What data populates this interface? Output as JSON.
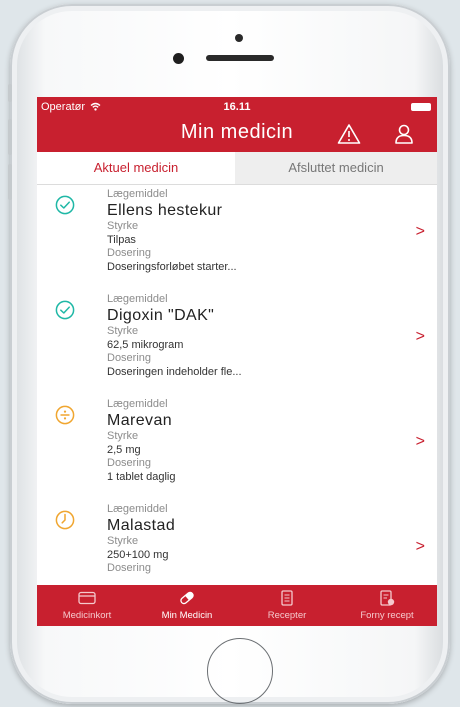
{
  "status_bar": {
    "carrier": "Operatør",
    "time": "16.11"
  },
  "header": {
    "title": "Min medicin",
    "warning_icon": "warning-icon",
    "profile_icon": "profile-icon"
  },
  "tabs": [
    {
      "label": "Aktuel medicin",
      "active": true
    },
    {
      "label": "Afsluttet medicin",
      "active": false
    }
  ],
  "medications": [
    {
      "icon": "check-circle-icon",
      "icon_color": "#1fb8a6",
      "drug_label": "Lægemiddel",
      "name": "Ellens hestekur",
      "strength_label": "Styrke",
      "strength": "Tilpas",
      "dosage_label": "Dosering",
      "dosage": "Doseringsforløbet starter..."
    },
    {
      "icon": "check-circle-icon",
      "icon_color": "#1fb8a6",
      "drug_label": "Lægemiddel",
      "name": "Digoxin \"DAK\"",
      "strength_label": "Styrke",
      "strength": "62,5 mikrogram",
      "dosage_label": "Dosering",
      "dosage": "Doseringen indeholder fle..."
    },
    {
      "icon": "divide-circle-icon",
      "icon_color": "#f0a630",
      "drug_label": "Lægemiddel",
      "name": "Marevan",
      "strength_label": "Styrke",
      "strength": "2,5 mg",
      "dosage_label": "Dosering",
      "dosage": "1 tablet daglig"
    },
    {
      "icon": "clock-circle-icon",
      "icon_color": "#f0a630",
      "drug_label": "Lægemiddel",
      "name": "Malastad",
      "strength_label": "Styrke",
      "strength": "250+100 mg",
      "dosage_label": "Dosering",
      "dosage": ""
    }
  ],
  "chevron": ">",
  "tab_bar": [
    {
      "label": "Medicinkort",
      "icon": "card-icon"
    },
    {
      "label": "Min Medicin",
      "icon": "pill-icon"
    },
    {
      "label": "Recepter",
      "icon": "prescription-icon"
    },
    {
      "label": "Forny recept",
      "icon": "renew-prescription-icon"
    }
  ],
  "colors": {
    "brand_red": "#c8202f",
    "check_teal": "#1fb8a6",
    "warning_orange": "#f0a630"
  }
}
